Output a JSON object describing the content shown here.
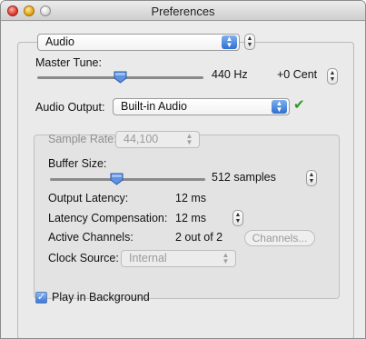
{
  "window": {
    "title": "Preferences"
  },
  "category": {
    "selected": "Audio"
  },
  "master_tune": {
    "label": "Master Tune:",
    "value_text": "440 Hz",
    "cent_text": "+0 Cent",
    "level": 0.5
  },
  "audio_output": {
    "label": "Audio Output:",
    "selected": "Built-in Audio",
    "status_icon": "checkmark-icon",
    "status_color": "#2a9a27"
  },
  "device": {
    "sample_rate": {
      "label": "Sample Rate:",
      "selected": "44,100"
    },
    "buffer_size": {
      "label": "Buffer Size:",
      "value_text": "512 samples",
      "level": 0.5
    },
    "output_latency": {
      "label": "Output Latency:",
      "value": "12 ms"
    },
    "latency_compensation": {
      "label": "Latency Compensation:",
      "value": "12 ms"
    },
    "active_channels": {
      "label": "Active Channels:",
      "value": "2 out of 2",
      "button_label": "Channels..."
    },
    "clock_source": {
      "label": "Clock Source:",
      "selected": "Internal"
    }
  },
  "play_in_background": {
    "label": "Play in Background",
    "checked": true
  },
  "colors": {
    "accent": "#3a78d4",
    "window_bg": "#ececec"
  }
}
